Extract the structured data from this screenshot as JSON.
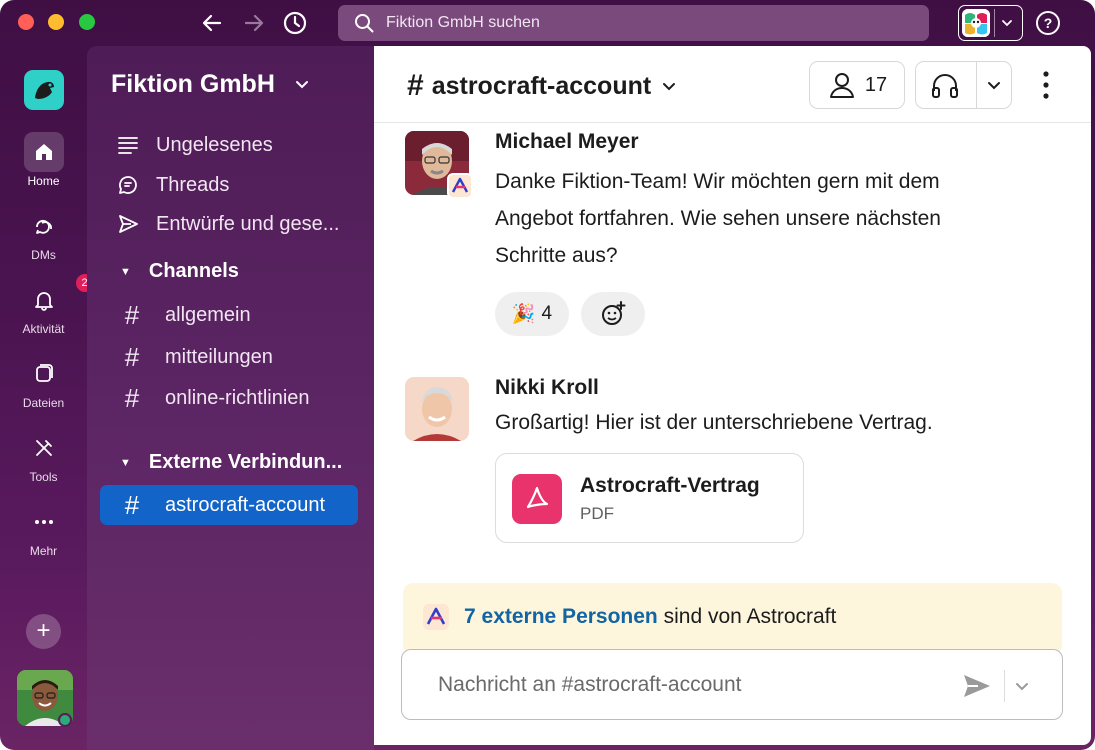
{
  "titlebar": {
    "search_placeholder": "Fiktion GmbH suchen"
  },
  "rail": {
    "items": [
      {
        "label": "Home",
        "icon": "home-icon"
      },
      {
        "label": "DMs",
        "icon": "dm-icon"
      },
      {
        "label": "Aktivität",
        "icon": "bell-icon",
        "badge": "2"
      },
      {
        "label": "Dateien",
        "icon": "files-icon"
      },
      {
        "label": "Tools",
        "icon": "tools-icon"
      },
      {
        "label": "Mehr",
        "icon": "more-dots-icon"
      }
    ],
    "add_label": "+"
  },
  "sidebar": {
    "workspace_name": "Fiktion GmbH",
    "nav": [
      {
        "label": "Ungelesenes",
        "icon": "unreads-icon"
      },
      {
        "label": "Threads",
        "icon": "threads-icon"
      },
      {
        "label": "Entwürfe und gese...",
        "icon": "send-icon"
      }
    ],
    "channels_section": "Channels",
    "channels": [
      "allgemein",
      "mitteilungen",
      "online-richtlinien"
    ],
    "external_section": "Externe Verbindun...",
    "external_channels": [
      "astrocraft-account"
    ]
  },
  "channel": {
    "hash": "#",
    "name": "astrocraft-account",
    "member_count": "17"
  },
  "messages": [
    {
      "author": "Michael Meyer",
      "text": "Danke Fiktion-Team! Wir möchten gern mit dem Angebot fortfahren. Wie sehen unsere nächsten Schritte aus?",
      "reactions": [
        {
          "emoji": "🎉",
          "count": "4"
        }
      ]
    },
    {
      "author": "Nikki Kroll",
      "text": "Großartig! Hier ist der unterschriebene Vertrag.",
      "file": {
        "name": "Astrocraft-Vertrag",
        "type": "PDF"
      }
    }
  ],
  "external_banner": {
    "link_text": "7 externe Personen",
    "rest_text": " sind von Astrocraft"
  },
  "composer": {
    "placeholder": "Nachricht an #astrocraft-account"
  },
  "colors": {
    "rail_bg": "#4a1450",
    "selected_channel": "#1264c8",
    "badge": "#e01e5a",
    "pdf": "#e8336c",
    "link": "#1264a3"
  }
}
